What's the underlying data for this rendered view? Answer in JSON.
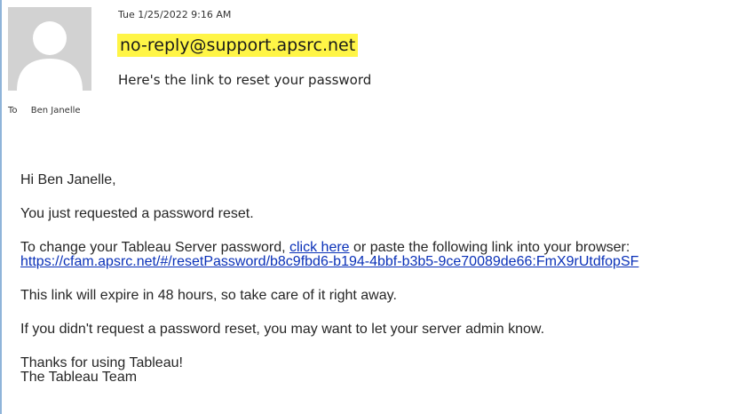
{
  "header": {
    "date": "Tue 1/25/2022 9:16 AM",
    "sender": "no-reply@support.apsrc.net",
    "subject": "Here's the link to reset your password",
    "to_label": "To",
    "to_name": "Ben Janelle",
    "highlight_color": "#fff546",
    "avatar_icon": "person-silhouette-icon"
  },
  "body": {
    "greeting": "Hi Ben Janelle,",
    "requested": "You just requested a password reset.",
    "change_before": "To change your Tableau Server password, ",
    "click_here": "click here",
    "change_after": " or paste the following link into your browser:",
    "reset_url": "https://cfam.apsrc.net/#/resetPassword/b8c9fbd6-b194-4bbf-b3b5-9ce70089de66:FmX9rUtdfopSF",
    "expire": "This link will expire in 48 hours, so take care of it right away.",
    "admin": "If you didn't request a password reset, you may want to let your server admin know.",
    "thanks": "Thanks for using Tableau!",
    "team": "The Tableau Team",
    "link_color": "#0a31b8"
  }
}
